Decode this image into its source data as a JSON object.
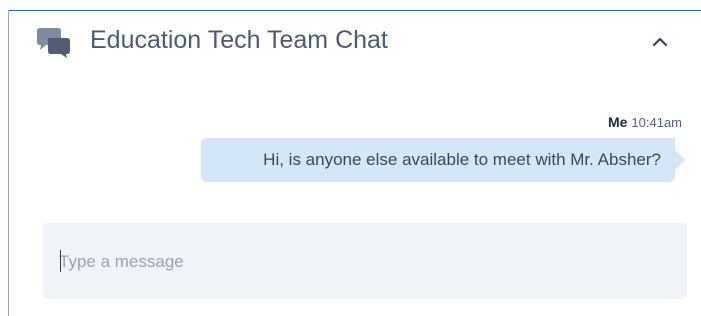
{
  "chat": {
    "title": "Education Tech Team Chat",
    "icon": "chat-bubbles-icon",
    "collapse_icon": "chevron-up-icon"
  },
  "messages": [
    {
      "sender": "Me",
      "time": "10:41am",
      "text": "Hi, is anyone else available to meet with Mr. Absher?"
    }
  ],
  "composer": {
    "placeholder": "Type a message",
    "value": ""
  },
  "colors": {
    "accent_border": "#2f62c9",
    "title_text": "#4a5a78",
    "bubble_bg": "#d5e6f7",
    "input_bg": "#f0f3f7"
  }
}
